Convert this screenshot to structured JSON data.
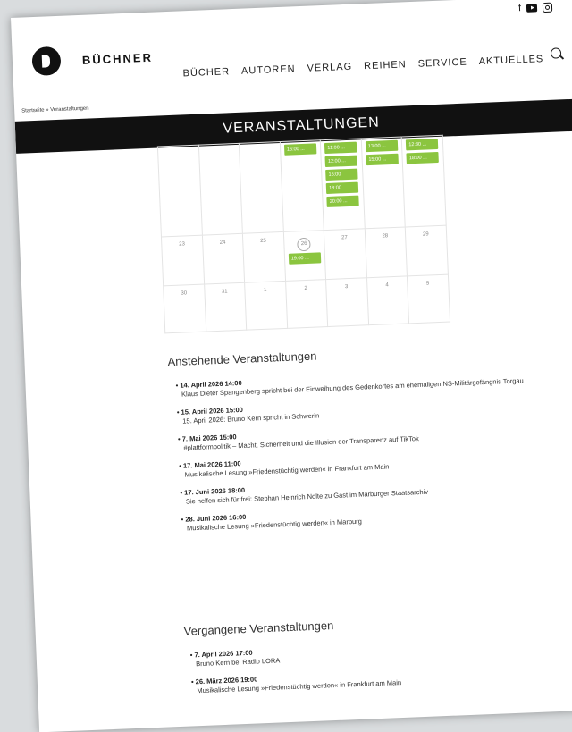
{
  "brand": {
    "name": "BÜCHNER"
  },
  "social": {
    "facebook": "f"
  },
  "nav": [
    "BÜCHER",
    "AUTOREN",
    "VERLAG",
    "REIHEN",
    "SERVICE",
    "AKTUELLES"
  ],
  "breadcrumb": "Startseite » Veranstaltungen",
  "page_title": "VERANSTALTUNGEN",
  "calendar": {
    "rows": [
      [
        {
          "events": []
        },
        {
          "events": []
        },
        {
          "events": []
        },
        {
          "events": [
            "16:00 ..."
          ]
        },
        {
          "events": [
            "11:00 ...",
            "12:00 ...",
            "16:00",
            "18:00",
            "20:00 ..."
          ]
        },
        {
          "events": [
            "13:00 ...",
            "15:00 ..."
          ]
        },
        {
          "events": [
            "12:30 ...",
            "18:00 ..."
          ]
        }
      ],
      [
        {
          "day": "23",
          "events": []
        },
        {
          "day": "24",
          "events": []
        },
        {
          "day": "25",
          "events": []
        },
        {
          "day": "26",
          "today": true,
          "events": [
            "19:00 ..."
          ]
        },
        {
          "day": "27",
          "events": []
        },
        {
          "day": "28",
          "events": []
        },
        {
          "day": "29",
          "events": []
        }
      ],
      [
        {
          "day": "30",
          "events": []
        },
        {
          "day": "31",
          "events": []
        },
        {
          "day": "1",
          "events": []
        },
        {
          "day": "2",
          "events": []
        },
        {
          "day": "3",
          "events": []
        },
        {
          "day": "4",
          "events": []
        },
        {
          "day": "5",
          "events": []
        }
      ]
    ]
  },
  "upcoming": {
    "heading": "Anstehende Veranstaltungen",
    "items": [
      {
        "date": "14. April 2026 14:00",
        "title": "Klaus Dieter Spangenberg spricht bei der Einweihung des Gedenkortes am ehemaligen NS-Militärgefängnis Torgau"
      },
      {
        "date": "15. April 2026 15:00",
        "title": "15. April 2026: Bruno Kern spricht in Schwerin"
      },
      {
        "date": "7. Mai 2026 15:00",
        "title": "#plattformpolitik – Macht, Sicherheit und die Illusion der Transparenz auf TikTok"
      },
      {
        "date": "17. Mai 2026 11:00",
        "title": "Musikalische Lesung »Friedenstüchtig werden« in Frankfurt am Main"
      },
      {
        "date": "17. Juni 2026 18:00",
        "title": "Sie helfen sich für frei: Stephan Heinrich Nolte zu Gast im Marburger Staatsarchiv"
      },
      {
        "date": "28. Juni 2026 16:00",
        "title": "Musikalische Lesung »Friedenstüchtig werden« in Marburg"
      }
    ]
  },
  "past": {
    "heading": "Vergangene Veranstaltungen",
    "items": [
      {
        "date": "7. April 2026 17:00",
        "title": "Bruno Kern bei Radio LORA"
      },
      {
        "date": "26. März 2026 19:00",
        "title": "Musikalische Lesung »Friedenstüchtig werden« in Frankfurt am Main"
      }
    ]
  }
}
